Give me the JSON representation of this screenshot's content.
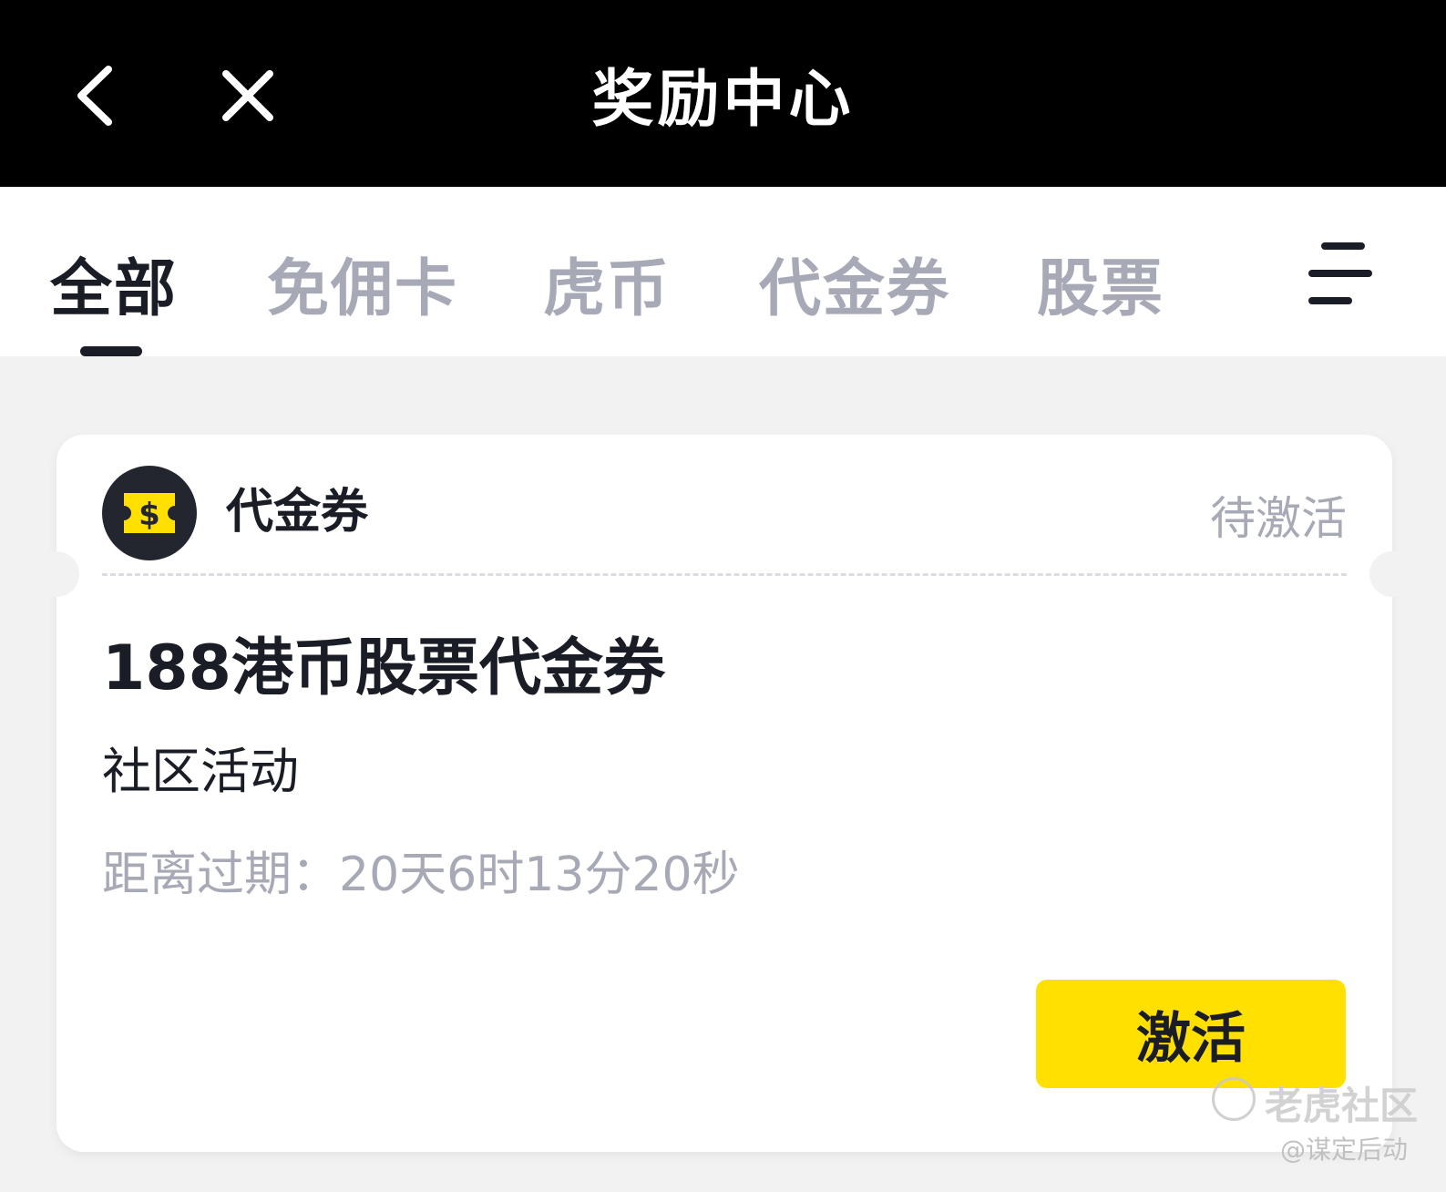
{
  "header": {
    "title": "奖励中心",
    "back_icon": "chevron-left-icon",
    "close_icon": "close-icon"
  },
  "tabs": {
    "items": [
      {
        "label": "全部",
        "active": true
      },
      {
        "label": "免佣卡",
        "active": false
      },
      {
        "label": "虎币",
        "active": false
      },
      {
        "label": "代金券",
        "active": false
      },
      {
        "label": "股票",
        "active": false
      }
    ],
    "menu_icon": "menu-icon"
  },
  "coupon": {
    "icon": "dollar-ticket-icon",
    "type_label": "代金券",
    "status": "待激活",
    "title": "188港币股票代金券",
    "source": "社区活动",
    "expiry": "距离过期：20天6时13分20秒",
    "action_label": "激活"
  },
  "watermark": {
    "brand": "老虎社区",
    "handle": "@谋定后动"
  },
  "colors": {
    "header_bg": "#000000",
    "accent_yellow": "#ffe000",
    "text_primary": "#1b1d26",
    "text_muted": "#a7aab6",
    "page_bg": "#f2f2f2"
  }
}
